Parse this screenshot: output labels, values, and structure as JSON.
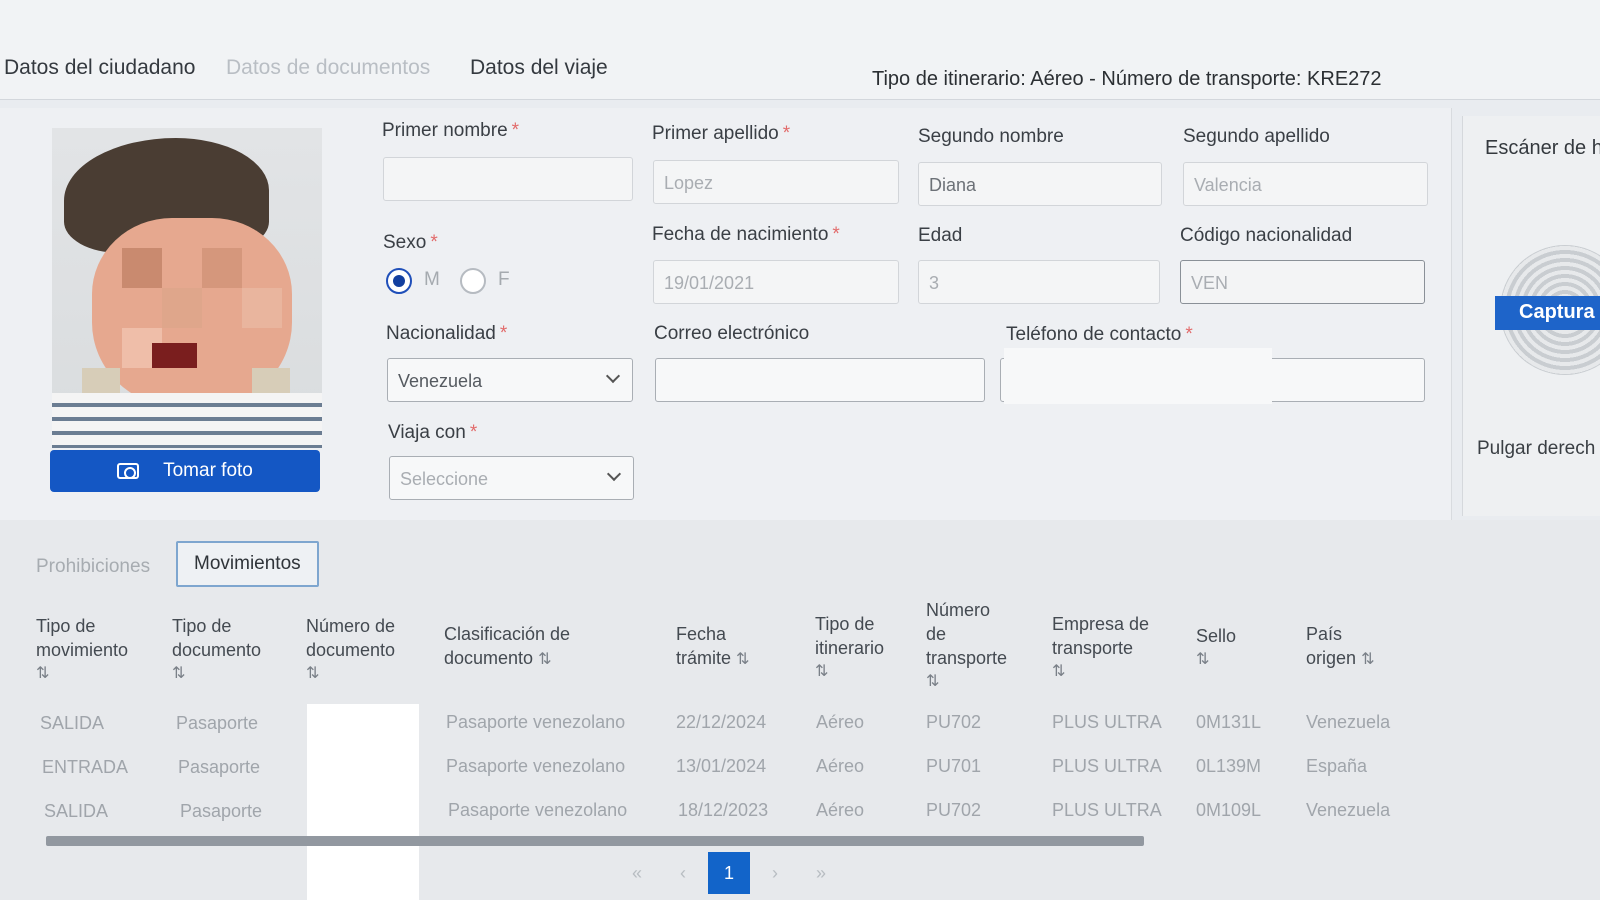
{
  "tabs": [
    {
      "label": "Datos del ciudadano",
      "state": "active"
    },
    {
      "label": "Datos de documentos",
      "state": "disabled"
    },
    {
      "label": "Datos del viaje",
      "state": "normal"
    }
  ],
  "itinerary": "Tipo de itinerario: Aéreo - Número de transporte: KRE272",
  "photo": {
    "button_label": "Tomar foto",
    "icon": "camera-icon"
  },
  "form": {
    "required_mark": "*",
    "primer_nombre": {
      "label": "Primer nombre",
      "value": ""
    },
    "primer_apellido": {
      "label": "Primer apellido",
      "value": "Lopez"
    },
    "segundo_nombre": {
      "label": "Segundo nombre",
      "value": "Diana"
    },
    "segundo_apellido": {
      "label": "Segundo apellido",
      "value": "Valencia"
    },
    "sexo": {
      "label": "Sexo",
      "options": [
        "M",
        "F"
      ],
      "selected": "M"
    },
    "fecha_nacimiento": {
      "label": "Fecha de nacimiento",
      "value": "19/01/2021"
    },
    "edad": {
      "label": "Edad",
      "value": "3"
    },
    "codigo_nacionalidad": {
      "label": "Código nacionalidad",
      "value": "VEN"
    },
    "nacionalidad": {
      "label": "Nacionalidad",
      "value": "Venezuela"
    },
    "correo": {
      "label": "Correo electrónico",
      "value": ""
    },
    "telefono": {
      "label": "Teléfono de contacto",
      "value": ""
    },
    "viaja_con": {
      "label": "Viaja con",
      "value": "Seleccione"
    }
  },
  "scanner": {
    "title": "Escáner de h",
    "capture_label": "Captura",
    "thumb_label": "Pulgar derech"
  },
  "bottom_tabs": [
    {
      "label": "Prohibiciones",
      "active": false
    },
    {
      "label": "Movimientos",
      "active": true
    }
  ],
  "sort_icon": "⇅",
  "table": {
    "headers": [
      [
        "Tipo de",
        "movimiento"
      ],
      [
        "Tipo de",
        "documento"
      ],
      [
        "Número de",
        "documento"
      ],
      [
        "Clasificación de",
        "documento"
      ],
      [
        "Fecha",
        "trámite"
      ],
      [
        "Tipo de",
        "itinerario"
      ],
      [
        "Número",
        "de",
        "transporte"
      ],
      [
        "Empresa de",
        "transporte"
      ],
      [
        "Sello"
      ],
      [
        "País",
        "origen"
      ]
    ],
    "rows": [
      [
        "SALIDA",
        "Pasaporte",
        "",
        "Pasaporte venezolano",
        "22/12/2024",
        "Aéreo",
        "PU702",
        "PLUS ULTRA",
        "0M131L",
        "Venezuela"
      ],
      [
        "ENTRADA",
        "Pasaporte",
        "",
        "Pasaporte venezolano",
        "13/01/2024",
        "Aéreo",
        "PU701",
        "PLUS ULTRA",
        "0L139M",
        "España"
      ],
      [
        "SALIDA",
        "Pasaporte",
        "",
        "Pasaporte venezolano",
        "18/12/2023",
        "Aéreo",
        "PU702",
        "PLUS ULTRA",
        "0M109L",
        "Venezuela"
      ]
    ]
  },
  "pagination": {
    "first": "«",
    "prev": "‹",
    "current": "1",
    "next": "›",
    "last": "»"
  },
  "colors": {
    "primary": "#1457c4",
    "required": "#e26b6b",
    "radio_checked": "#123f9f"
  }
}
